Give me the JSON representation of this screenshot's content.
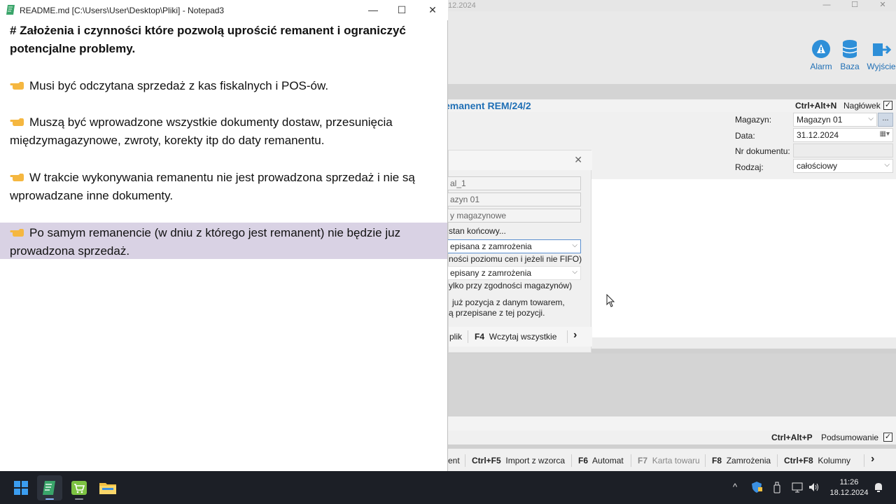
{
  "notepad": {
    "title": "README.md [C:\\Users\\User\\Desktop\\Pliki] - Notepad3",
    "lines": {
      "heading1": "# Założenia i czynności które pozwolą uprościć remanent i ograniczyć",
      "heading2": "potencjalne problemy.",
      "item1": "Musi być odczytana sprzedaż z kas fiskalnych i POS-ów.",
      "item2a": "Muszą być wprowadzone wszystkie dokumenty dostaw, przesunięcia",
      "item2b": "międzymagazynowe, zwroty, korekty itp do daty remanentu.",
      "item3a": "W trakcie wykonywania remanentu nie jest prowadzona sprzedaż i nie są",
      "item3b": "wprowadzane inne dokumenty.",
      "item4a": "Po samym remanencie  (w dniu z którego jest remanent) nie będzie juz",
      "item4b": "prowadzona sprzedaż."
    },
    "controls": {
      "minimize": "—",
      "maximize": "☐",
      "close": "✕"
    }
  },
  "erp": {
    "title_fragment": "12.2024",
    "toolbar": [
      {
        "label": "Alarm",
        "icon": "alarm-icon"
      },
      {
        "label": "Baza",
        "icon": "database-icon"
      },
      {
        "label": "Wyjście",
        "icon": "exit-icon"
      }
    ],
    "doc_title": "emanent REM/24/2",
    "header_shortcut": "Ctrl+Alt+N",
    "header_toggle_label": "Nagłówek",
    "fields": {
      "magazyn_label": "Magazyn:",
      "magazyn_value": "Magazyn 01",
      "data_label": "Data:",
      "data_value": "31.12.2024",
      "nr_label": "Nr dokumentu:",
      "nr_value": "",
      "rodzaj_label": "Rodzaj:",
      "rodzaj_value": "całościowy"
    },
    "more_button": "...",
    "dialog": {
      "close": "✕",
      "input1": "al_1",
      "input2": "azyn 01",
      "input3": "y magazynowe",
      "text1": "stan końcowy...",
      "select1": "episana z zamrożenia",
      "text2": "ności poziomu cen i jeżeli nie FIFO)",
      "select2": "episany z zamrożenia",
      "text3": "ylko przy zgodności magazynów)",
      "text4": "już pozycja z danym towarem,",
      "text5": "ą przepisane z tej pozycji.",
      "footer_file": "plik",
      "footer_key": "F4",
      "footer_label": "Wczytaj wszystkie",
      "footer_next": "›"
    },
    "summary_shortcut": "Ctrl+Alt+P",
    "summary_label": "Podsumowanie",
    "fkeys": [
      {
        "key": "",
        "label": "ent"
      },
      {
        "key": "Ctrl+F5",
        "label": "Import z wzorca"
      },
      {
        "key": "F6",
        "label": "Automat"
      },
      {
        "key": "F7",
        "label": "Karta towaru"
      },
      {
        "key": "F8",
        "label": "Zamrożenia"
      },
      {
        "key": "Ctrl+F8",
        "label": "Kolumny"
      }
    ],
    "fkeys_next": "›"
  },
  "taskbar": {
    "time": "11:26",
    "date": "18.12.2024",
    "tray_arrow": "^"
  },
  "colors": {
    "accent_blue": "#1f6fb5",
    "highlight_purple": "#d9d2e4",
    "taskbar": "#1c1f26"
  }
}
